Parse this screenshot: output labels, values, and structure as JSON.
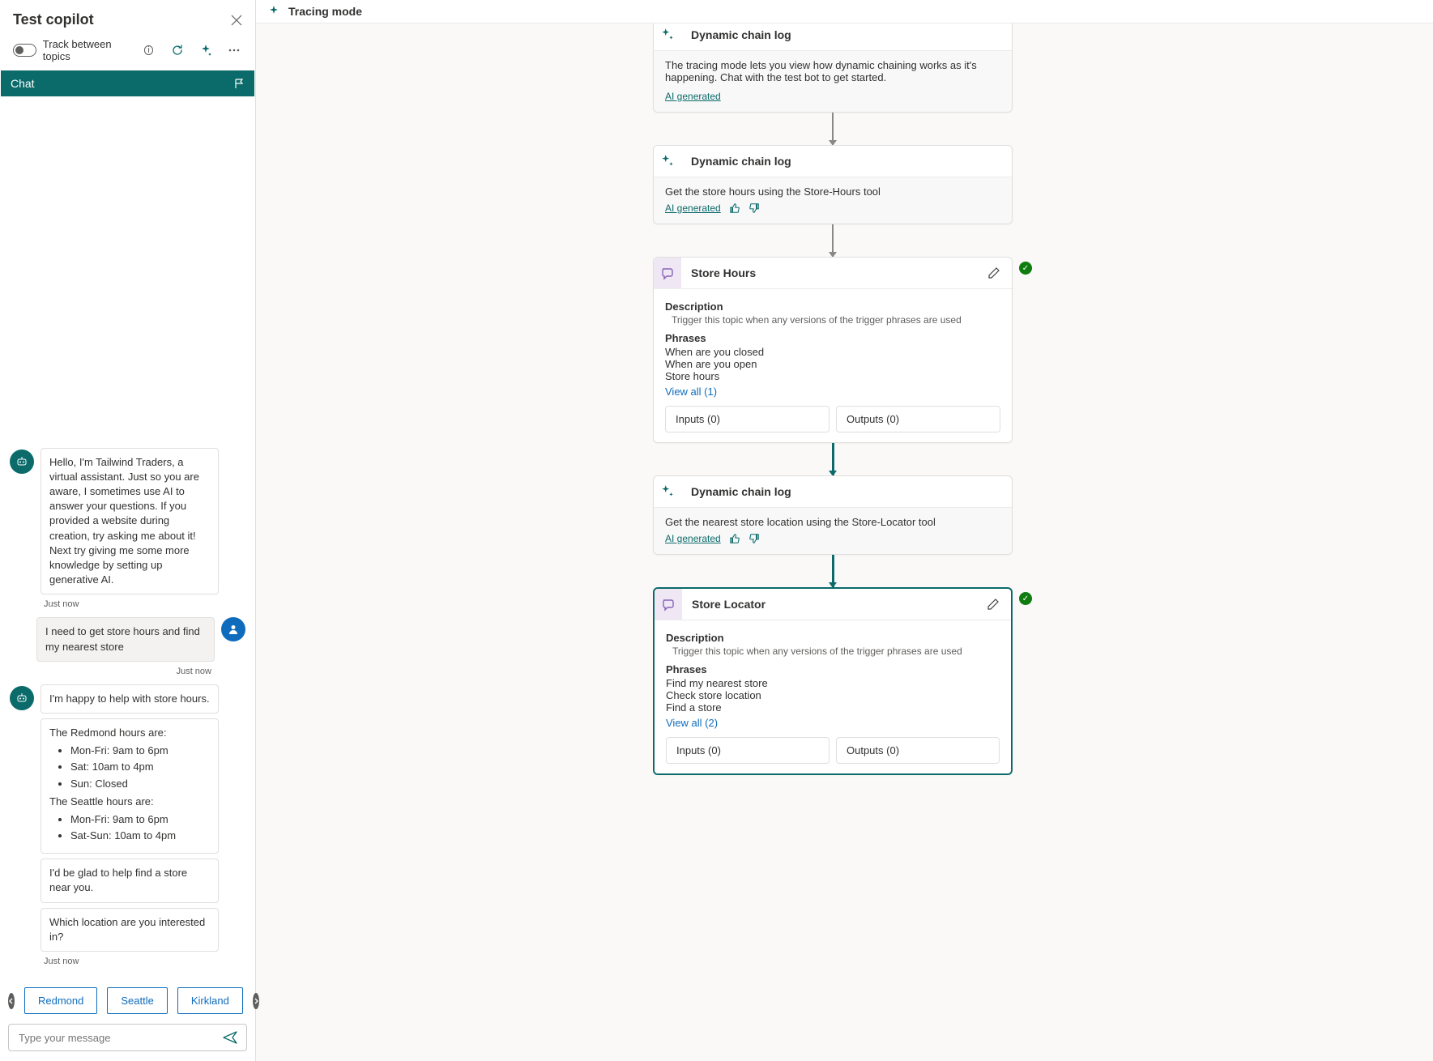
{
  "panel": {
    "title": "Test copilot",
    "track_label": "Track between topics",
    "chat_tab": "Chat"
  },
  "chat": {
    "bot_intro": "Hello, I'm Tailwind Traders, a virtual assistant. Just so you are aware, I sometimes use AI to answer your questions. If you provided a website during creation, try asking me about it! Next try giving me some more knowledge by setting up generative AI.",
    "ts1": "Just now",
    "user_msg": "I need to get store hours and find my nearest store",
    "ts2": "Just now",
    "bot_happy": "I'm happy to help with store hours.",
    "hours_redmond_head": "The Redmond hours are:",
    "hours_redmond": [
      "Mon-Fri: 9am to 6pm",
      "Sat: 10am to 4pm",
      "Sun: Closed"
    ],
    "hours_seattle_head": "The Seattle hours are:",
    "hours_seattle": [
      "Mon-Fri: 9am to 6pm",
      "Sat-Sun: 10am to 4pm"
    ],
    "bot_glad": "I'd be glad to help find a store near you.",
    "bot_which": "Which location are you interested in?",
    "ts3": "Just now",
    "suggestions": [
      "Redmond",
      "Seattle",
      "Kirkland"
    ],
    "input_placeholder": "Type your message"
  },
  "tracing": {
    "header": "Tracing mode",
    "log_title": "Dynamic chain log",
    "intro_text": "The tracing mode lets you view how dynamic chaining works as it's happening. Chat with the test bot to get started.",
    "ai_gen": "AI generated",
    "step1_text": "Get the store hours using the Store-Hours tool",
    "step2_text": "Get the nearest store location using the Store-Locator tool",
    "store_hours": {
      "title": "Store Hours",
      "desc_label": "Description",
      "desc": "Trigger this topic when any versions of the trigger phrases are used",
      "phrases_label": "Phrases",
      "phrases": [
        "When are you closed",
        "When are you open",
        "Store hours"
      ],
      "view_all": "View all (1)",
      "inputs": "Inputs (0)",
      "outputs": "Outputs (0)"
    },
    "store_locator": {
      "title": "Store Locator",
      "desc_label": "Description",
      "desc": "Trigger this topic when any versions of the trigger phrases are used",
      "phrases_label": "Phrases",
      "phrases": [
        "Find my nearest store",
        "Check store location",
        "Find a store"
      ],
      "view_all": "View all (2)",
      "inputs": "Inputs (0)",
      "outputs": "Outputs (0)"
    }
  }
}
